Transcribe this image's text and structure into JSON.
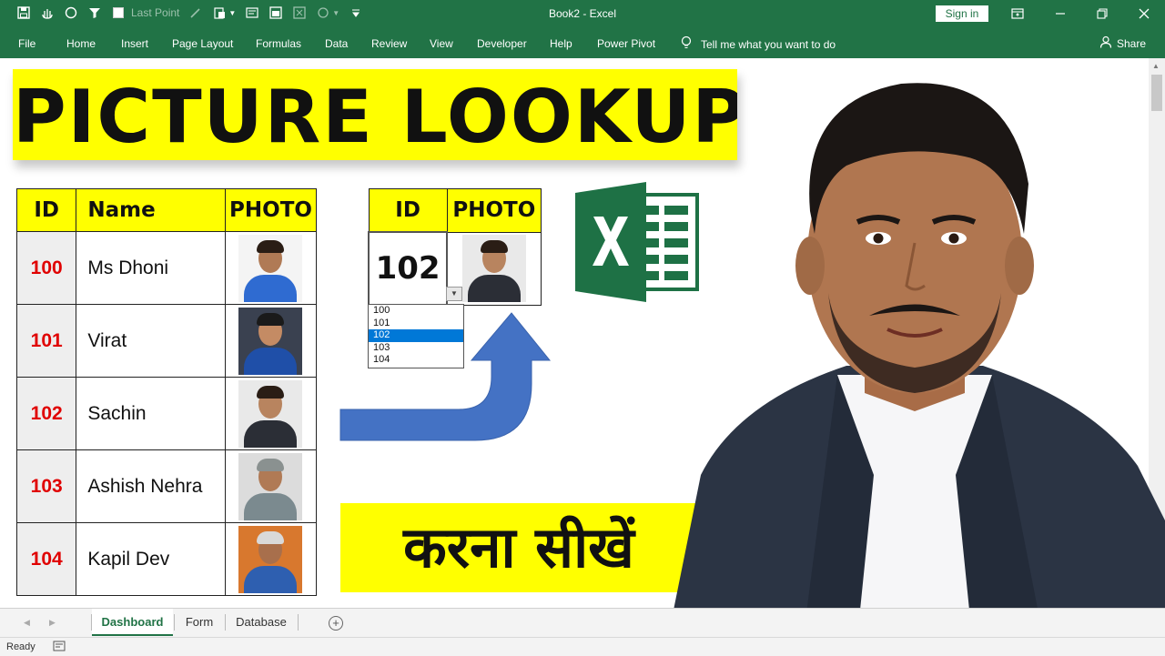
{
  "window": {
    "title": "Book2  -  Excel",
    "sign_in": "Sign in",
    "qat_last_point": "Last Point"
  },
  "ribbon": {
    "tabs": [
      "File",
      "Home",
      "Insert",
      "Page Layout",
      "Formulas",
      "Data",
      "Review",
      "View",
      "Developer",
      "Help",
      "Power Pivot"
    ],
    "tell_me": "Tell me what you want to do",
    "share": "Share"
  },
  "banner": {
    "title": "PICTURE LOOKUP"
  },
  "main_table": {
    "headers": [
      "ID",
      "Name",
      "PHOTO"
    ],
    "rows": [
      {
        "id": "100",
        "name": "Ms Dhoni"
      },
      {
        "id": "101",
        "name": "Virat"
      },
      {
        "id": "102",
        "name": "Sachin"
      },
      {
        "id": "103",
        "name": "Ashish Nehra"
      },
      {
        "id": "104",
        "name": "Kapil Dev"
      }
    ]
  },
  "lookup_table": {
    "headers": [
      "ID",
      "PHOTO"
    ],
    "value": "102",
    "dropdown_options": [
      "100",
      "101",
      "102",
      "103",
      "104"
    ],
    "selected_option": "102"
  },
  "hindi_banner": {
    "text": "करना सीखें"
  },
  "sheet_tabs": {
    "tabs": [
      "Dashboard",
      "Form",
      "Database"
    ],
    "active": "Dashboard"
  },
  "status": {
    "text": "Ready"
  },
  "colors": {
    "excel_green": "#217346",
    "highlight_yellow": "#ffff00",
    "id_red": "#e00000",
    "arrow_blue": "#4472c4",
    "selection_blue": "#0078d7"
  }
}
